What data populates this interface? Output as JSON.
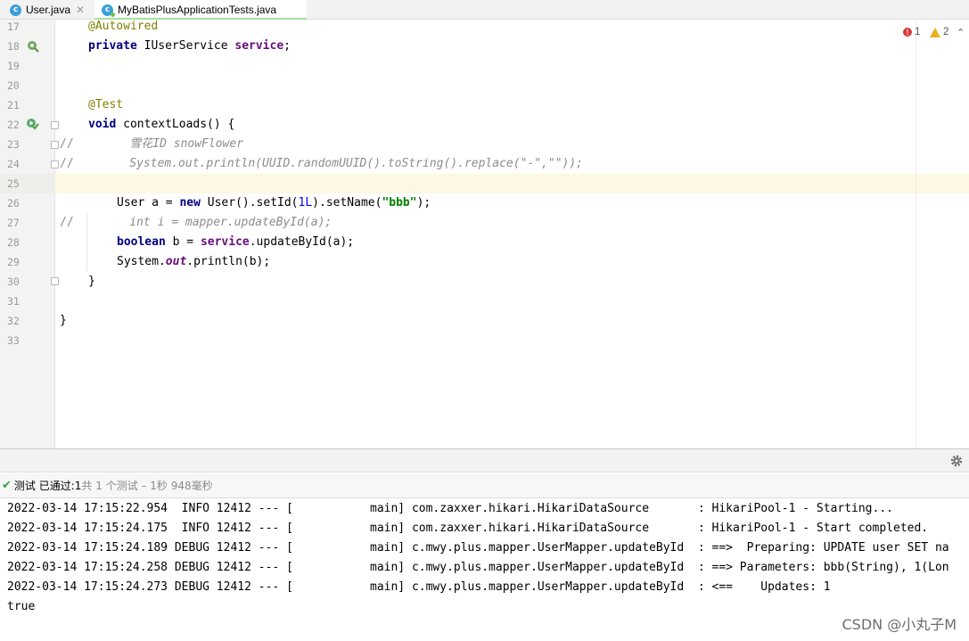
{
  "tabs": [
    {
      "label": "User.java",
      "icon": "class-c-icon"
    },
    {
      "label": "MyBatisPlusApplicationTests.java",
      "icon": "class-c-icon",
      "active": true
    }
  ],
  "inspections": {
    "errors": "1",
    "warnings": "2"
  },
  "editor": {
    "line_numbers": [
      "17",
      "18",
      "19",
      "20",
      "21",
      "22",
      "23",
      "24",
      "25",
      "26",
      "27",
      "28",
      "29",
      "30",
      "31",
      "32",
      "33"
    ],
    "current_line": "25"
  },
  "code": {
    "l17_ann": "@Autowired",
    "l18_kw": "private",
    "l18_type": " IUserService ",
    "l18_field": "service",
    "l18_end": ";",
    "l21_ann": "@Test",
    "l22_kw": "void",
    "l22_rest": " contextLoads() {",
    "l23_prefix": "//",
    "l23_comment": "        雪花ID snowFlower",
    "l24_prefix": "//",
    "l24_comment": "        System.out.println(UUID.randomUUID().toString().replace(\"-\",\"\"));",
    "l26_a": "User a = ",
    "l26_kw": "new",
    "l26_b": " User().setId(",
    "l26_num": "1L",
    "l26_c": ").setName(",
    "l26_str": "\"bbb\"",
    "l26_d": ");",
    "l27_prefix": "//",
    "l27_comment": "        int i = mapper.updateById(a);",
    "l28_kw": "boolean",
    "l28_a": " b = ",
    "l28_field": "service",
    "l28_b": ".updateById(a);",
    "l29_a": "System.",
    "l29_static": "out",
    "l29_b": ".println(b);",
    "l30": "}",
    "l32": "}"
  },
  "test_status": {
    "label": "测试 已通过: ",
    "passed": "1",
    "detail": "共 1 个测试 – 1秒 948毫秒"
  },
  "console": [
    "2022-03-14 17:15:22.954  INFO 12412 --- [           main] com.zaxxer.hikari.HikariDataSource       : HikariPool-1 - Starting...",
    "2022-03-14 17:15:24.175  INFO 12412 --- [           main] com.zaxxer.hikari.HikariDataSource       : HikariPool-1 - Start completed.",
    "2022-03-14 17:15:24.189 DEBUG 12412 --- [           main] c.mwy.plus.mapper.UserMapper.updateById  : ==>  Preparing: UPDATE user SET na",
    "2022-03-14 17:15:24.258 DEBUG 12412 --- [           main] c.mwy.plus.mapper.UserMapper.updateById  : ==> Parameters: bbb(String), 1(Lon",
    "2022-03-14 17:15:24.273 DEBUG 12412 --- [           main] c.mwy.plus.mapper.UserMapper.updateById  : <==    Updates: 1",
    "true"
  ],
  "watermark": "CSDN @小丸子M"
}
